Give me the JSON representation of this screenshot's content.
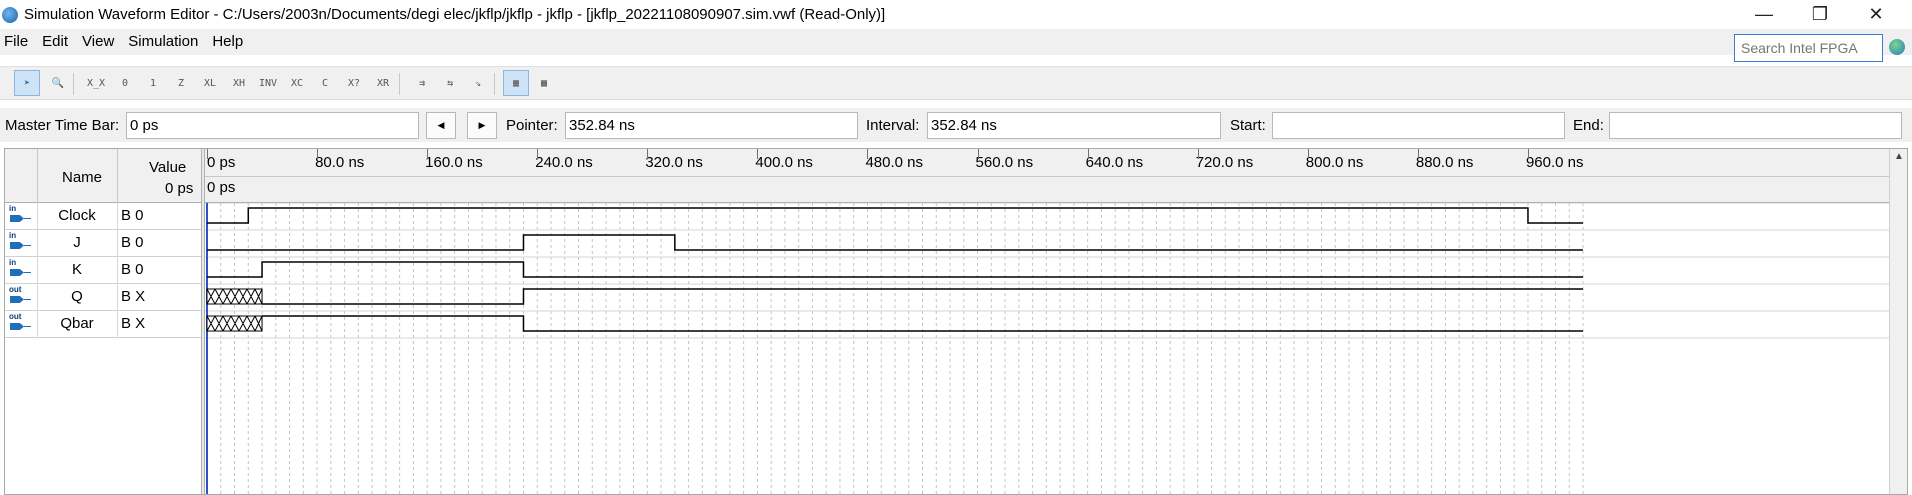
{
  "window": {
    "title": "Simulation Waveform Editor - C:/Users/2003n/Documents/degi elec/jkflp/jkflp - jkflp - [jkflp_20221108090907.sim.vwf (Read-Only)]",
    "minimize_glyph": "—",
    "maximize_glyph": "❐",
    "close_glyph": "✕"
  },
  "menu": {
    "items": [
      {
        "label": "File"
      },
      {
        "label": "Edit"
      },
      {
        "label": "View"
      },
      {
        "label": "Simulation"
      },
      {
        "label": "Help"
      }
    ],
    "search_placeholder": "Search Intel FPGA"
  },
  "toolbar": {
    "buttons": [
      {
        "icon": "selection-arrow-icon",
        "glyph": "➤",
        "active": true
      },
      {
        "icon": "zoom-icon",
        "glyph": "🔍"
      },
      {
        "icon": "unknown-value-icon",
        "glyph": "X̲X"
      },
      {
        "icon": "force-low-icon",
        "glyph": "0"
      },
      {
        "icon": "force-high-icon",
        "glyph": "1"
      },
      {
        "icon": "high-impedance-icon",
        "glyph": "Z"
      },
      {
        "icon": "weak-low-icon",
        "glyph": "XL"
      },
      {
        "icon": "weak-high-icon",
        "glyph": "XH"
      },
      {
        "icon": "invert-icon",
        "glyph": "INV"
      },
      {
        "icon": "count-value-icon",
        "glyph": "XC"
      },
      {
        "icon": "clock-value-icon",
        "glyph": "C"
      },
      {
        "icon": "arbitrary-value-icon",
        "glyph": "X?"
      },
      {
        "icon": "random-value-icon",
        "glyph": "XR"
      },
      {
        "icon": "snap-to-grid-icon",
        "glyph": "⇉"
      },
      {
        "icon": "sort-icon",
        "glyph": "⇆"
      },
      {
        "icon": "grid-icon",
        "glyph": "⇘"
      },
      {
        "icon": "waveform-view-icon",
        "glyph": "▦",
        "active": true
      },
      {
        "icon": "tabular-view-icon",
        "glyph": "▩"
      }
    ]
  },
  "timebar": {
    "master_label": "Master Time Bar:",
    "master_value": "0 ps",
    "prev_glyph": "◀",
    "next_glyph": "▶",
    "pointer_label": "Pointer:",
    "pointer_value": "352.84 ns",
    "interval_label": "Interval:",
    "interval_value": "352.84 ns",
    "start_label": "Start:",
    "start_value": "",
    "end_label": "End:",
    "end_value": ""
  },
  "signals_header": {
    "name": "Name",
    "value": "Value",
    "value_time": "0 ps"
  },
  "signals": [
    {
      "dir": "in",
      "name": "Clock",
      "value": "B 0"
    },
    {
      "dir": "in",
      "name": "J",
      "value": "B 0"
    },
    {
      "dir": "in",
      "name": "K",
      "value": "B 0"
    },
    {
      "dir": "out",
      "name": "Q",
      "value": "B X"
    },
    {
      "dir": "out",
      "name": "Qbar",
      "value": "B X"
    }
  ],
  "time_scale": {
    "labels": [
      "0 ps",
      "80.0 ns",
      "160.0 ns",
      "240.0 ns",
      "320.0 ns",
      "400.0 ns",
      "480.0 ns",
      "560.0 ns",
      "640.0 ns",
      "720.0 ns",
      "800.0 ns",
      "880.0 ns",
      "960.0 ns"
    ],
    "pointer_label": "0 ps",
    "range_ns": [
      0,
      1000
    ]
  },
  "waveforms": {
    "Clock": [
      {
        "from": 0,
        "to": 30,
        "level": 0
      },
      {
        "from": 30,
        "to": 960,
        "level": 1
      },
      {
        "from": 960,
        "to": 1000,
        "level": 0
      }
    ],
    "J": [
      {
        "from": 0,
        "to": 230,
        "level": 0
      },
      {
        "from": 230,
        "to": 340,
        "level": 1
      },
      {
        "from": 340,
        "to": 1000,
        "level": 0
      }
    ],
    "K": [
      {
        "from": 0,
        "to": 40,
        "level": 0
      },
      {
        "from": 40,
        "to": 230,
        "level": 1
      },
      {
        "from": 230,
        "to": 1000,
        "level": 0
      }
    ],
    "Q": [
      {
        "from": 0,
        "to": 40,
        "level": "X"
      },
      {
        "from": 40,
        "to": 230,
        "level": 0
      },
      {
        "from": 230,
        "to": 1000,
        "level": 1
      }
    ],
    "Qbar": [
      {
        "from": 0,
        "to": 40,
        "level": "X"
      },
      {
        "from": 40,
        "to": 230,
        "level": 1
      },
      {
        "from": 230,
        "to": 1000,
        "level": 0
      }
    ]
  }
}
